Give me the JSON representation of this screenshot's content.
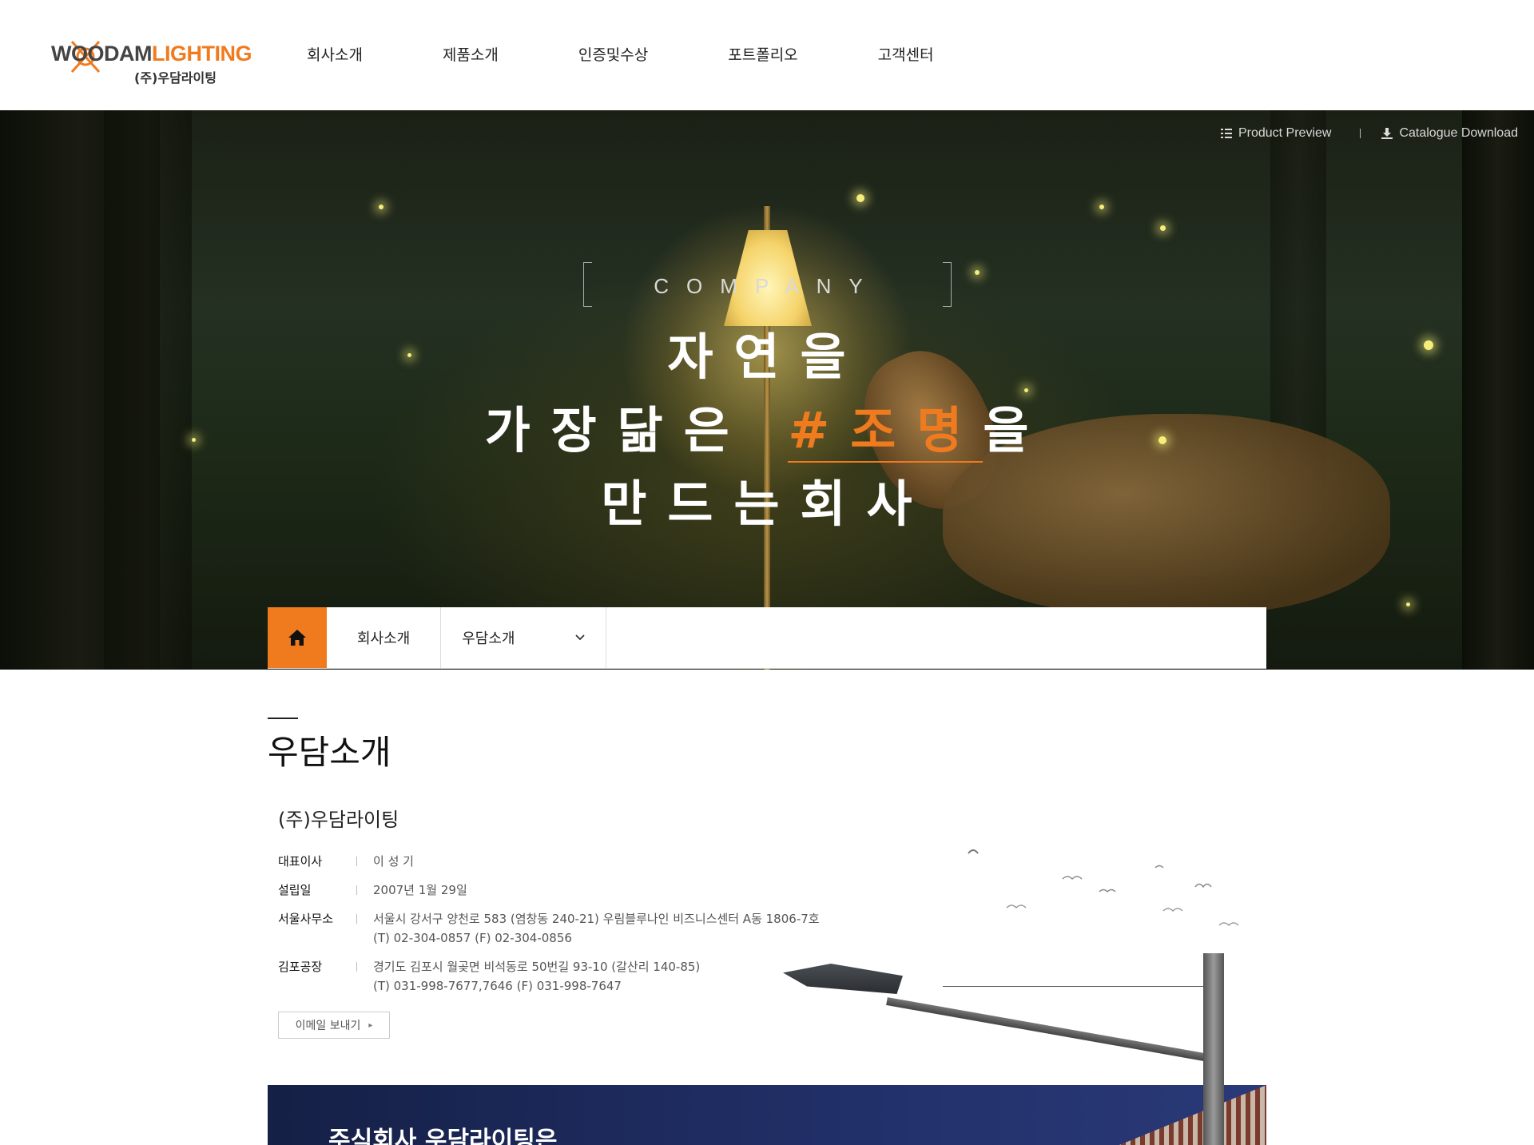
{
  "brand": {
    "logo_text_dark": "WOODAM",
    "logo_text_orange": "LIGHTING",
    "logo_sub": "(주)우담라이팅",
    "orange": "#f07b1f"
  },
  "nav": {
    "items": [
      {
        "label": "회사소개"
      },
      {
        "label": "제품소개"
      },
      {
        "label": "인증및수상"
      },
      {
        "label": "포트폴리오"
      },
      {
        "label": "고객센터"
      }
    ]
  },
  "hero": {
    "top_links": [
      {
        "label": "Product Preview",
        "icon": "list-icon"
      },
      {
        "label": "Catalogue Download",
        "icon": "download-icon"
      }
    ],
    "subtitle": "COMPANY",
    "line1": "자연을",
    "line2_before": "가장닮은",
    "line2_highlight": "#조명",
    "line2_after": "을",
    "line3": "만드는회사"
  },
  "breadcrumb": {
    "home_icon": "home-icon",
    "level1": "회사소개",
    "level2": "우담소개"
  },
  "content": {
    "page_title": "우담소개",
    "company_name": "(주)우담라이팅",
    "rows": [
      {
        "label": "대표이사",
        "value": "이 성 기",
        "value2": ""
      },
      {
        "label": "설립일",
        "value": "2007년 1월 29일",
        "value2": ""
      },
      {
        "label": "서울사무소",
        "value": "서울시 강서구 양천로 583 (염창동 240-21) 우림블루나인 비즈니스센터 A동 1806-7호",
        "value2": "(T) 02-304-0857 (F) 02-304-0856"
      },
      {
        "label": "김포공장",
        "value": "경기도 김포시 월곶면 비석동로 50번길 93-10 (갈산리 140-85)",
        "value2": "(T) 031-998-7677,7646 (F) 031-998-7647"
      }
    ],
    "email_button": "이메일 보내기",
    "banner_text": "주식회사 우담라이팅은"
  }
}
